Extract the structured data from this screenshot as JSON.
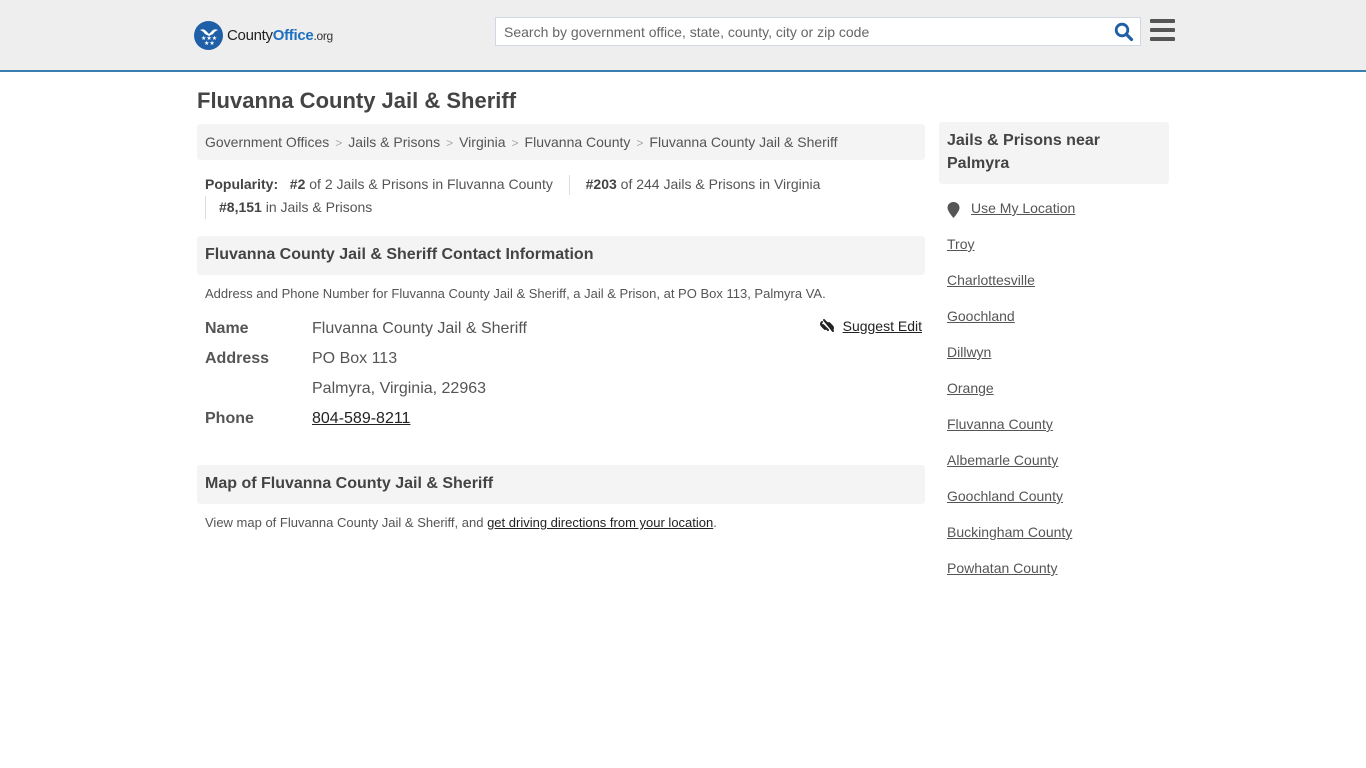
{
  "header": {
    "logo": {
      "name": "County",
      "accent": "Office",
      "tld": ".org"
    },
    "search": {
      "placeholder": "Search by government office, state, county, city or zip code",
      "value": ""
    },
    "colors": {
      "brand_blue": "#1f5fa8",
      "header_border": "#3a7fb0",
      "header_bg": "#eeeeee"
    }
  },
  "page": {
    "title": "Fluvanna County Jail & Sheriff"
  },
  "breadcrumb": [
    {
      "label": "Government Offices"
    },
    {
      "label": "Jails & Prisons"
    },
    {
      "label": "Virginia"
    },
    {
      "label": "Fluvanna County"
    },
    {
      "label": "Fluvanna County Jail & Sheriff"
    }
  ],
  "popularity": {
    "label": "Popularity:",
    "items": [
      {
        "rank": "#2",
        "text": " of 2 Jails & Prisons in Fluvanna County"
      },
      {
        "rank": "#203",
        "text": " of 244 Jails & Prisons in Virginia"
      },
      {
        "rank": "#8,151",
        "text": " in Jails & Prisons"
      }
    ]
  },
  "contact": {
    "heading": "Fluvanna County Jail & Sheriff Contact Information",
    "description": "Address and Phone Number for Fluvanna County Jail & Sheriff, a Jail & Prison, at PO Box 113, Palmyra VA.",
    "suggest_edit": "Suggest Edit",
    "fields": {
      "name_label": "Name",
      "name_value": "Fluvanna County Jail & Sheriff",
      "address_label": "Address",
      "address_line1": "PO Box 113",
      "address_line2": "Palmyra, Virginia, 22963",
      "phone_label": "Phone",
      "phone_value": "804-589-8211"
    }
  },
  "map": {
    "heading": "Map of Fluvanna County Jail & Sheriff",
    "desc_prefix": "View map of Fluvanna County Jail & Sheriff, and ",
    "desc_link": "get driving directions from your location",
    "desc_suffix": "."
  },
  "sidebar": {
    "heading": "Jails & Prisons near Palmyra",
    "use_location": "Use My Location",
    "links": [
      "Troy",
      "Charlottesville",
      "Goochland",
      "Dillwyn",
      "Orange",
      "Fluvanna County",
      "Albemarle County",
      "Goochland County",
      "Buckingham County",
      "Powhatan County"
    ]
  }
}
